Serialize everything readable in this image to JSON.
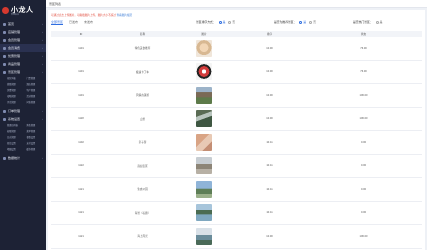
{
  "app": {
    "brand": "小龙人",
    "brand_sub": "管理后台"
  },
  "sidebar": {
    "items": [
      {
        "label": "首页",
        "sub": []
      },
      {
        "label": "店铺管理",
        "sub": []
      },
      {
        "label": "会员管理",
        "sub": []
      },
      {
        "label": "会员消费",
        "sub": [],
        "highlight": true
      },
      {
        "label": "优惠管理",
        "sub": []
      },
      {
        "label": "商品管理",
        "sub": []
      },
      {
        "label": "景区管理",
        "sub": [
          "景区列表",
          "门票管理",
          "线路管理",
          "酒店管理",
          "美食管理",
          "特产管理",
          "攻略管理",
          "活动管理",
          "评论管理",
          "问答管理"
        ]
      },
      {
        "label": "订单管理",
        "sub": []
      },
      {
        "label": "系统设置",
        "sub": [
          "管理员列表",
          "角色管理",
          "权限管理",
          "菜单管理",
          "日志管理",
          "参数设置",
          "短信设置",
          "支付设置",
          "地图设置",
          "缓存管理"
        ]
      },
      {
        "label": "数据统计",
        "sub": []
      }
    ]
  },
  "topbar": {
    "tab": "景区列表"
  },
  "notice": {
    "text": "可通过点击上传图片，可拖拽图片上传，图片大小不超过",
    "link": "查看图片规范"
  },
  "filters": {
    "tabs": [
      "全部景区",
      "已发布",
      "未发布"
    ],
    "sort_label": "景区排序方式：",
    "sort_options": [
      {
        "label": "是",
        "on": true
      },
      {
        "label": "否",
        "on": false
      }
    ],
    "recommend_label": "是否为推荐景区：",
    "recommend_options": [
      {
        "label": "是",
        "on": true
      },
      {
        "label": "否",
        "on": false
      }
    ],
    "hot_label": "是否热门景区：",
    "hot_options": [
      {
        "label": "是",
        "on": false
      }
    ]
  },
  "table": {
    "headers": [
      "ID",
      "名称",
      "图片",
      "排序",
      "状态"
    ],
    "rows": [
      {
        "id": "1101",
        "name": "特色美食推荐",
        "thumb": "food",
        "sort": "10.00",
        "status": "76.00"
      },
      {
        "id": "1101",
        "name": "极速卡丁车",
        "thumb": "tire",
        "sort": "10.00",
        "status": "76.00"
      },
      {
        "id": "1101",
        "name": "风情古镇游",
        "thumb": "town",
        "sort": "10.00",
        "status": "106.00"
      },
      {
        "id": "1118",
        "name": "山景",
        "thumb": "mount",
        "sort": "10.00",
        "status": "106.00"
      },
      {
        "id": "1102",
        "name": "亲子游",
        "thumb": "people",
        "sort": "10.11",
        "status": "0.00"
      },
      {
        "id": "1122",
        "name": "商业街区",
        "thumb": "shop",
        "sort": "10.11",
        "status": "0.00"
      },
      {
        "id": "1121",
        "name": "生态公园",
        "thumb": "sky",
        "sort": "10.11",
        "status": "0.00"
      },
      {
        "id": "1121",
        "name": "海景（标题）",
        "thumb": "sea",
        "sort": "10.11",
        "status": "0.00"
      },
      {
        "id": "1121",
        "name": "海上风光",
        "thumb": "coast",
        "sort": "10.00",
        "status": "106.00"
      }
    ]
  }
}
